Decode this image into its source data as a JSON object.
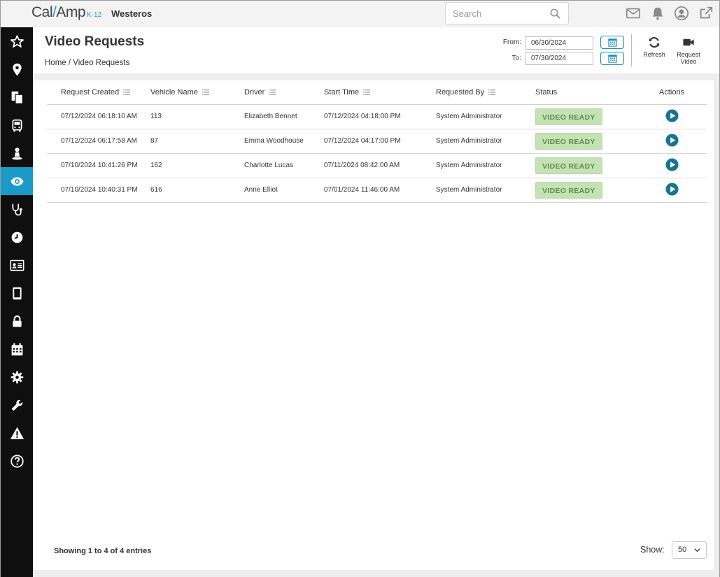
{
  "brand": {
    "name_a": "Cal",
    "name_b": "Amp",
    "suffix": "K-12",
    "org": "Westeros",
    "accent": "#1a9bc7"
  },
  "search": {
    "placeholder": "Search"
  },
  "topbar_icons": [
    "mail-icon",
    "bell-icon",
    "user-icon",
    "external-link-icon"
  ],
  "sidebar": {
    "items": [
      {
        "icon": "star-icon",
        "active": false
      },
      {
        "icon": "map-pin-icon",
        "active": false
      },
      {
        "icon": "documents-icon",
        "active": false
      },
      {
        "icon": "bus-icon",
        "active": false
      },
      {
        "icon": "driver-icon",
        "active": false
      },
      {
        "icon": "eye-icon",
        "active": true
      },
      {
        "icon": "stethoscope-icon",
        "active": false
      },
      {
        "icon": "clock-icon",
        "active": false
      },
      {
        "icon": "id-card-icon",
        "active": false
      },
      {
        "icon": "tablet-icon",
        "active": false
      },
      {
        "icon": "lock-icon",
        "active": false
      },
      {
        "icon": "calendar-icon",
        "active": false
      },
      {
        "icon": "gear-icon",
        "active": false
      },
      {
        "icon": "wrench-icon",
        "active": false
      },
      {
        "icon": "warning-icon",
        "active": false
      },
      {
        "icon": "help-icon",
        "active": false
      }
    ]
  },
  "header": {
    "title": "Video Requests",
    "breadcrumb": "Home / Video Requests",
    "from_label": "From:",
    "from_value": "06/30/2024",
    "to_label": "To:",
    "to_value": "07/30/2024",
    "refresh_label": "Refresh",
    "request_label_1": "Request",
    "request_label_2": "Video"
  },
  "table": {
    "columns": [
      "Request Created",
      "Vehicle Name",
      "Driver",
      "Start Time",
      "Requested By",
      "Status",
      "Actions"
    ],
    "rows": [
      {
        "created": "07/12/2024 06:18:10 AM",
        "vehicle": "113",
        "driver": "Elizabeth Bennet",
        "start": "07/12/2024 04:18:00 PM",
        "by": "System Administrator",
        "status": "VIDEO READY"
      },
      {
        "created": "07/12/2024 06:17:58 AM",
        "vehicle": "87",
        "driver": "Emma Woodhouse",
        "start": "07/12/2024 04:17:00 PM",
        "by": "System Administrator",
        "status": "VIDEO READY"
      },
      {
        "created": "07/10/2024 10:41:26 PM",
        "vehicle": "162",
        "driver": "Charlotte Lucas",
        "start": "07/11/2024 08:42:00 AM",
        "by": "System Administrator",
        "status": "VIDEO READY"
      },
      {
        "created": "07/10/2024 10:40:31 PM",
        "vehicle": "616",
        "driver": "Anne Elliot",
        "start": "07/01/2024 11:46:00 AM",
        "by": "System Administrator",
        "status": "VIDEO READY"
      }
    ]
  },
  "footer": {
    "entries": "Showing 1 to 4 of 4 entries",
    "show_label": "Show:",
    "show_value": "50"
  }
}
